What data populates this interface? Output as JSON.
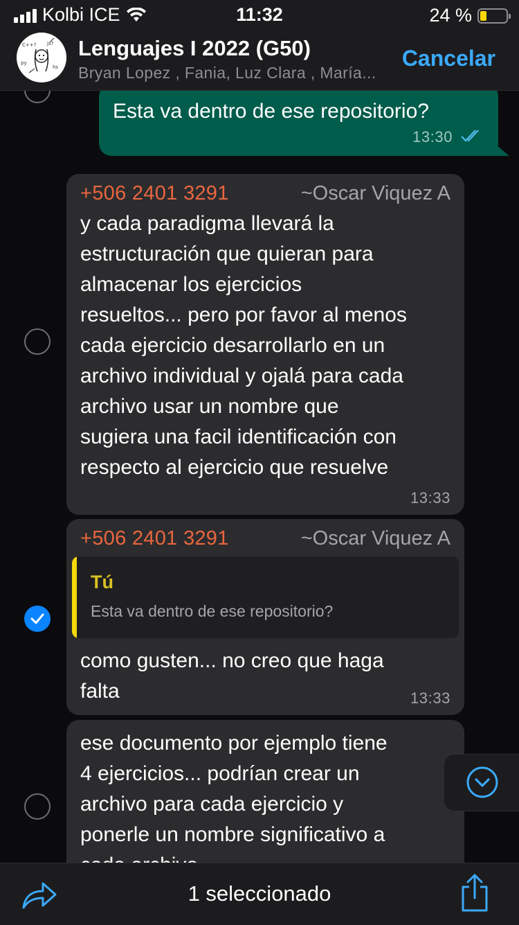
{
  "status_bar": {
    "carrier": "Kolbi ICE",
    "time": "11:32",
    "battery": "24 %",
    "battery_level": 0.24
  },
  "header": {
    "title": "Lenguajes I 2022 (G50)",
    "members": "Bryan Lopez , Fania, Luz Clara , María...",
    "cancel_label": "Cancelar"
  },
  "messages": [
    {
      "direction": "out",
      "text": [
        "Esta va dentro de ese repositorio?"
      ],
      "time": "13:30",
      "status": "read",
      "selected": false
    },
    {
      "direction": "in",
      "sender_phone": "+506 2401 3291",
      "sender_name": "~Oscar Viquez A",
      "text": [
        "y cada paradigma llevará la",
        "estructuración que quieran para",
        "almacenar los ejercicios",
        "resueltos... pero por favor al menos",
        "cada ejercicio desarrollarlo en un",
        "archivo individual y ojalá para cada",
        "archivo usar un nombre que",
        "sugiera una facil identificación con",
        "respecto al ejercicio que resuelve"
      ],
      "time": "13:33",
      "selected": false
    },
    {
      "direction": "in",
      "sender_phone": "+506 2401 3291",
      "sender_name": "~Oscar Viquez A",
      "quote": {
        "author": "Tú",
        "text": "Esta va dentro de ese repositorio?"
      },
      "text": [
        "como gusten... no creo que haga",
        "falta"
      ],
      "time": "13:33",
      "selected": true
    },
    {
      "direction": "in",
      "text": [
        "ese documento por ejemplo tiene",
        "4 ejercicios... podrían crear un",
        "archivo para cada ejercicio y",
        "ponerle un nombre significativo a",
        "cada archivo"
      ],
      "selected": false
    }
  ],
  "toolbar": {
    "selection_label": "1 seleccionado"
  },
  "icons": {
    "forward": "forward-arrow-icon",
    "share": "share-icon",
    "scroll_down": "chevron-down-circle-icon",
    "read_receipt": "double-check-icon",
    "select": "checkmark-icon"
  },
  "colors": {
    "accent": "#3ba9f8",
    "outgoing_bubble": "#005c4b",
    "incoming_bubble": "#2c2c2e",
    "sender_phone": "#e9663f",
    "quote_bar": "#f5d90a",
    "selected_radio": "#0a84ff",
    "battery": "#ffd60a"
  }
}
